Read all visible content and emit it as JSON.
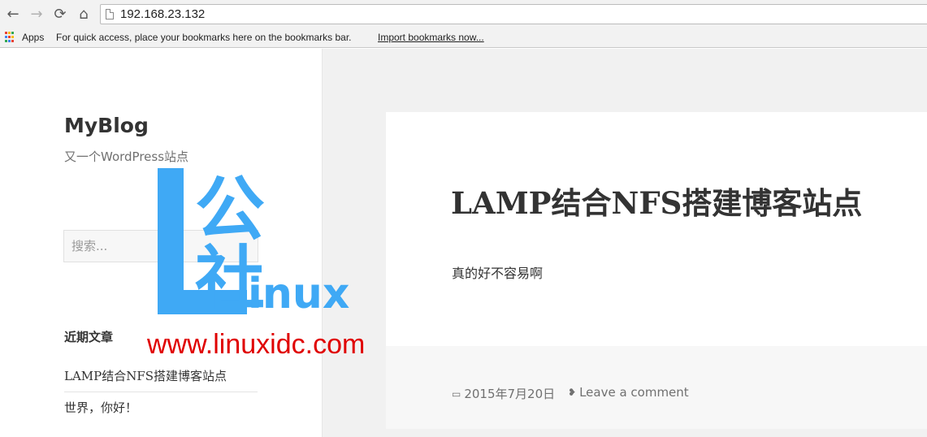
{
  "browser": {
    "back_icon": "←",
    "forward_icon": "→",
    "reload_icon": "⟳",
    "home_icon": "⌂",
    "url": "192.168.23.132",
    "apps_label": "Apps",
    "bookmarks_message": "For quick access, place your bookmarks here on the bookmarks bar.",
    "import_link": "Import bookmarks now..."
  },
  "site": {
    "title": "MyBlog",
    "description": "又一个WordPress站点"
  },
  "search": {
    "placeholder": "搜索..."
  },
  "recent_posts": {
    "title": "近期文章",
    "items": [
      "LAMP结合NFS搭建博客站点",
      "世界，你好！"
    ]
  },
  "watermark": {
    "brand_cn": "公社",
    "brand_latin": "inux",
    "site": "www.linuxidc.com",
    "color": "#3fa9f5",
    "site_color": "#e00000"
  },
  "article": {
    "title": "LAMP结合NFS搭建博客站点",
    "body": "真的好不容易啊",
    "date": "2015年7月20日",
    "comment_link": "Leave a comment",
    "date_icon": "▭",
    "comment_icon": "❥"
  }
}
